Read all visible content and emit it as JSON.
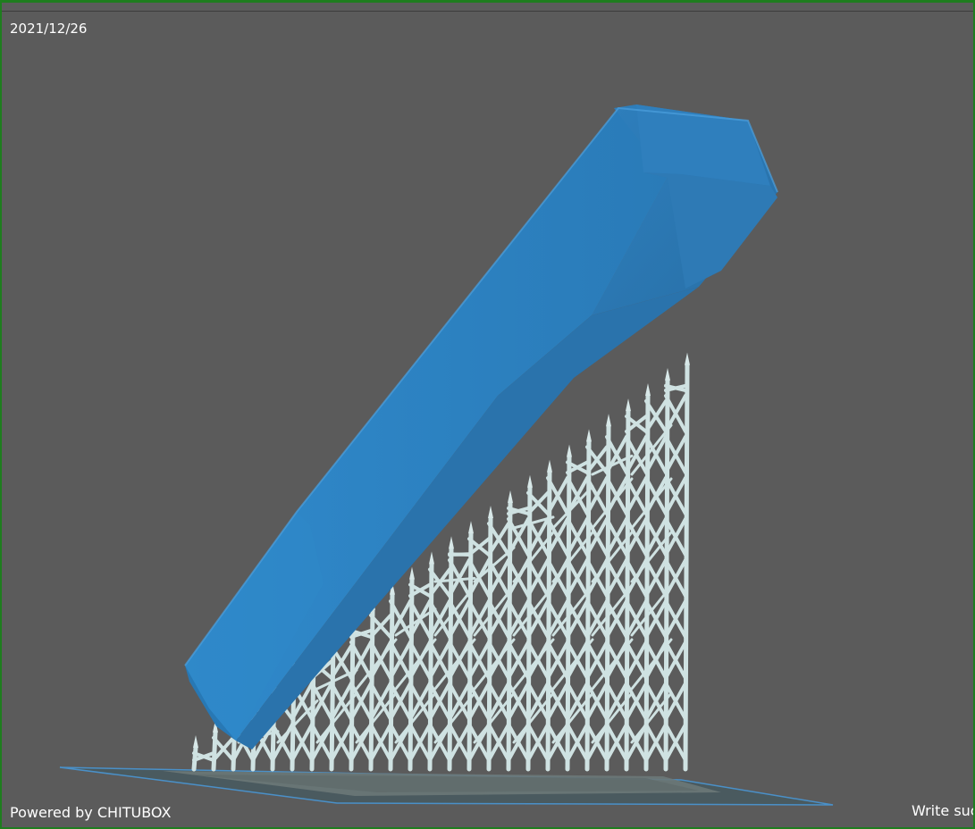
{
  "viewport": {
    "date": "2021/12/26",
    "powered_by": "Powered by CHITUBOX",
    "status_text": "Write suc"
  },
  "colors": {
    "background": "#5b5b5b",
    "frame": "#1e7d1e",
    "model_blue": "#2f86c6",
    "support": "#c8dcdc",
    "build_plate": "#3a6a8a"
  },
  "model": {
    "name-icon": "blue-part-3d-model"
  }
}
